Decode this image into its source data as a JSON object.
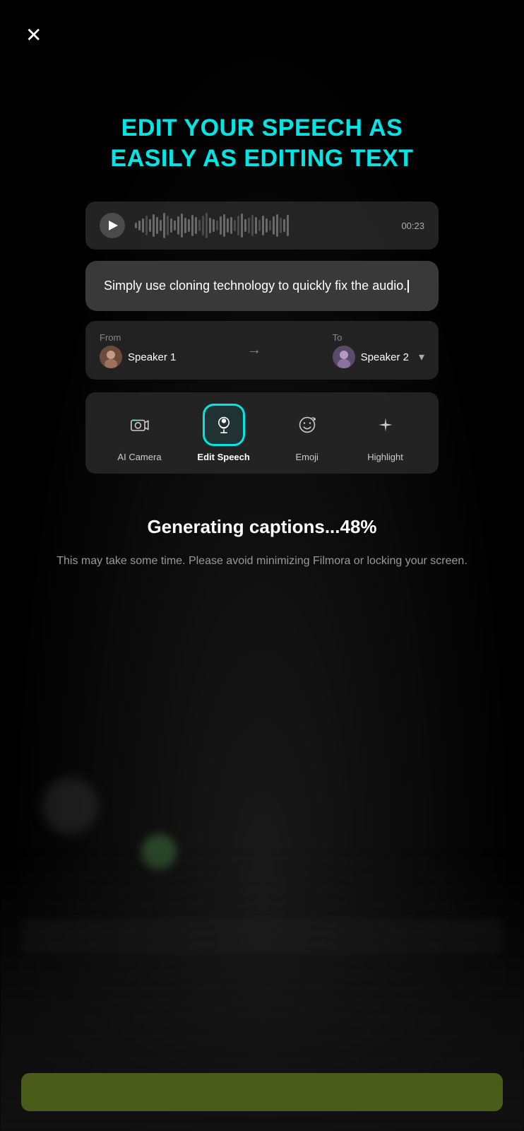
{
  "close_button": "✕",
  "title_line1": "EDIT YOUR SPEECH AS",
  "title_line2": "EASILY AS EDITING TEXT",
  "audio": {
    "timestamp": "00:23"
  },
  "text_content": "Simply use cloning technology to quickly fix the audio.",
  "speakers": {
    "from_label": "From",
    "to_label": "To",
    "speaker1_name": "Speaker 1",
    "speaker2_name": "Speaker 2"
  },
  "tools": [
    {
      "id": "ai-camera",
      "label": "AI Camera",
      "active": false
    },
    {
      "id": "edit-speech",
      "label": "Edit Speech",
      "active": true
    },
    {
      "id": "emoji",
      "label": "Emoji",
      "active": false
    },
    {
      "id": "highlight",
      "label": "Highlight",
      "active": false
    }
  ],
  "generating": {
    "title": "Generating captions...48%",
    "subtitle": "This may take some time. Please avoid minimizing Filmora or locking your screen."
  }
}
